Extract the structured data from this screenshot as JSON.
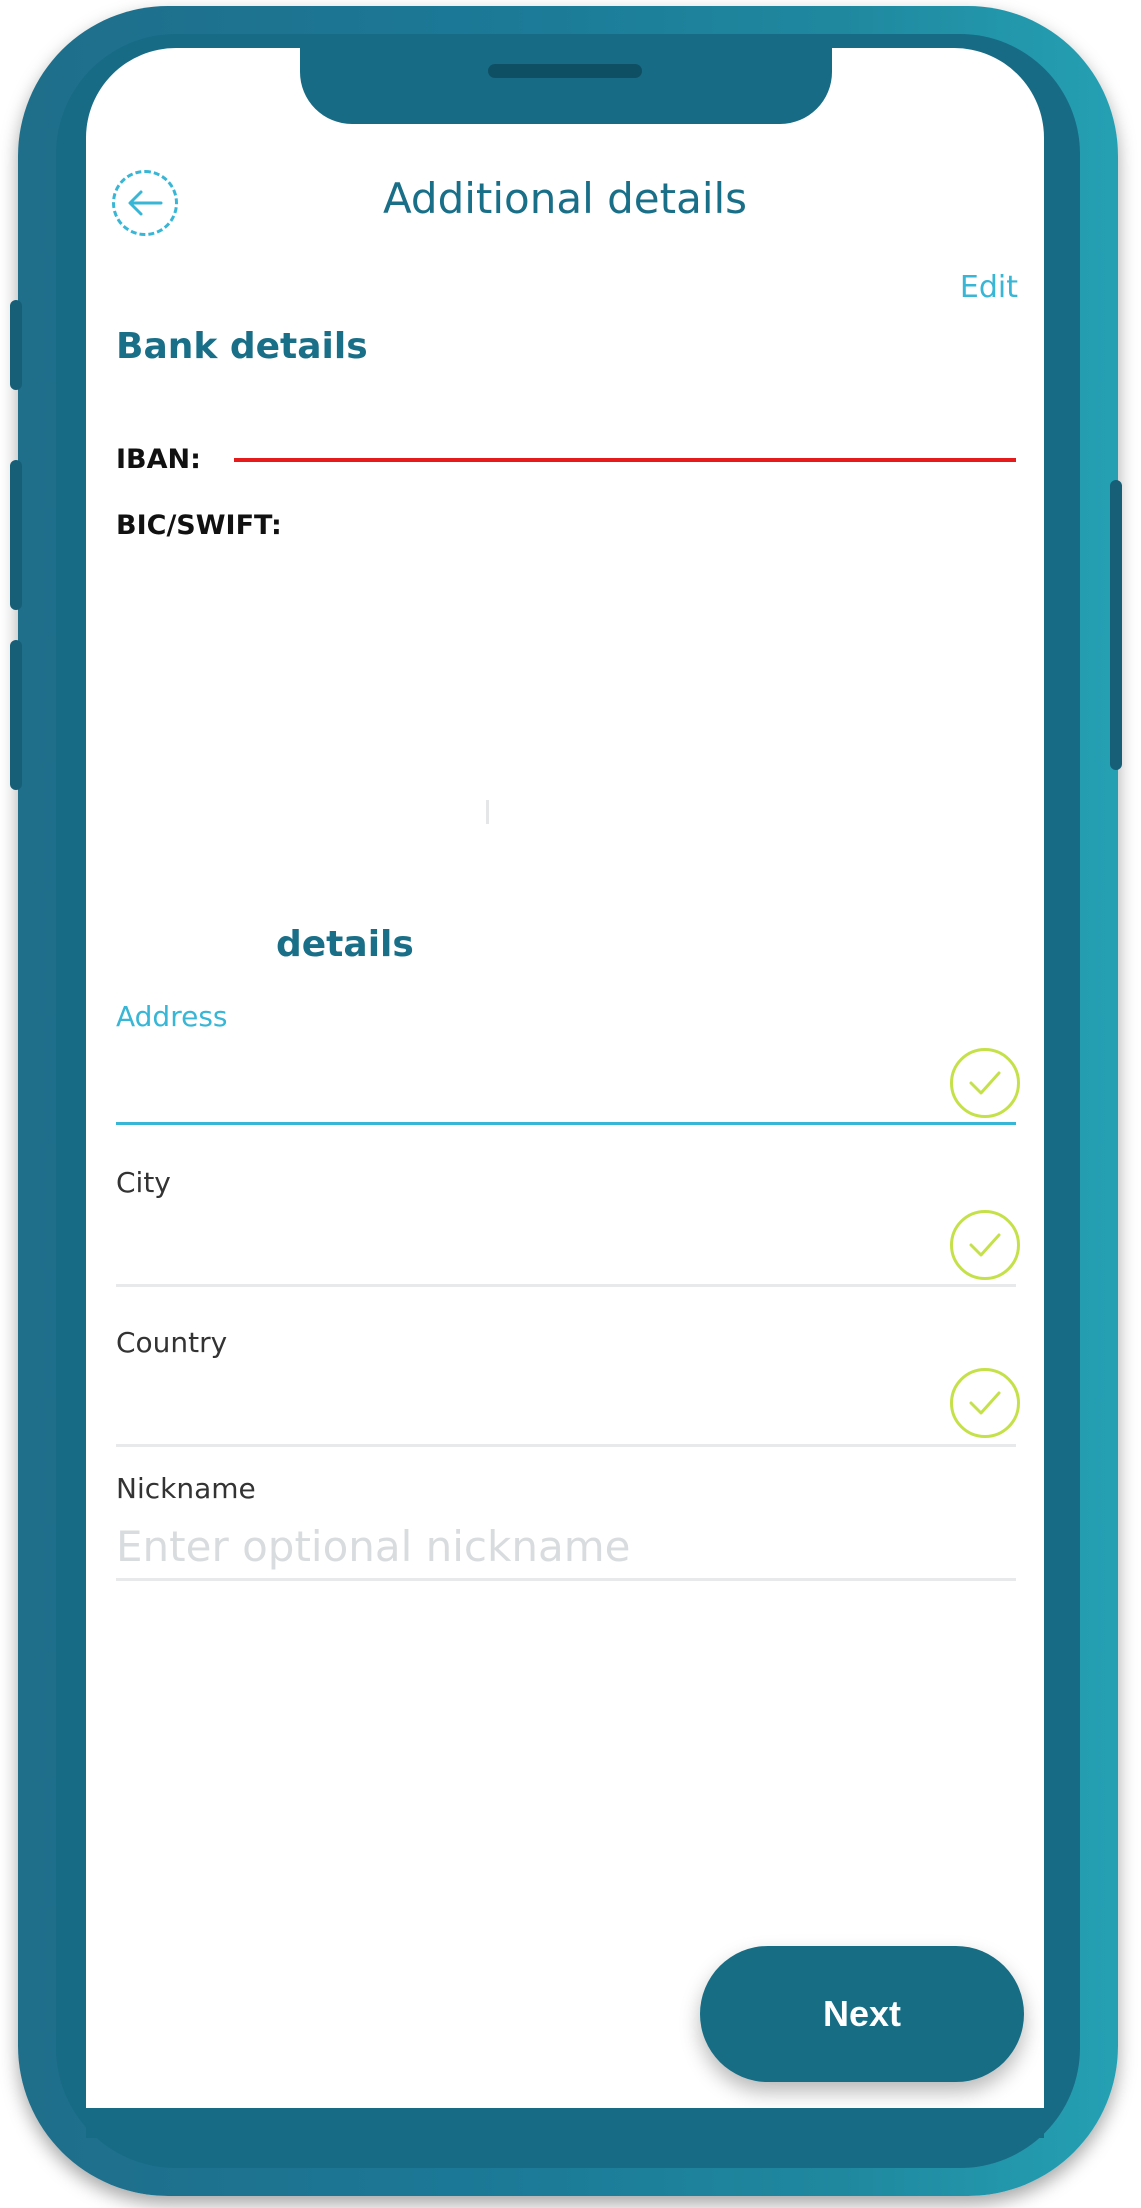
{
  "header": {
    "title": "Additional details",
    "back_icon": "arrow-left-circle-icon"
  },
  "bank_details": {
    "title": "Bank details",
    "edit_label": "Edit",
    "iban_label": "IBAN:",
    "bic_label": "BIC/SWIFT:"
  },
  "recipient_details": {
    "title_suffix": "details"
  },
  "fields": {
    "address_label": "Address",
    "city_label": "City",
    "country_label": "Country",
    "nickname_label": "Nickname",
    "nickname_placeholder": "Enter optional nickname"
  },
  "actions": {
    "next_label": "Next"
  },
  "colors": {
    "brand_teal": "#1a6f88",
    "accent_cyan": "#38b6d6",
    "check_lime": "#c5e14a",
    "error_red": "#e51b1b",
    "button_teal": "#166d84"
  }
}
